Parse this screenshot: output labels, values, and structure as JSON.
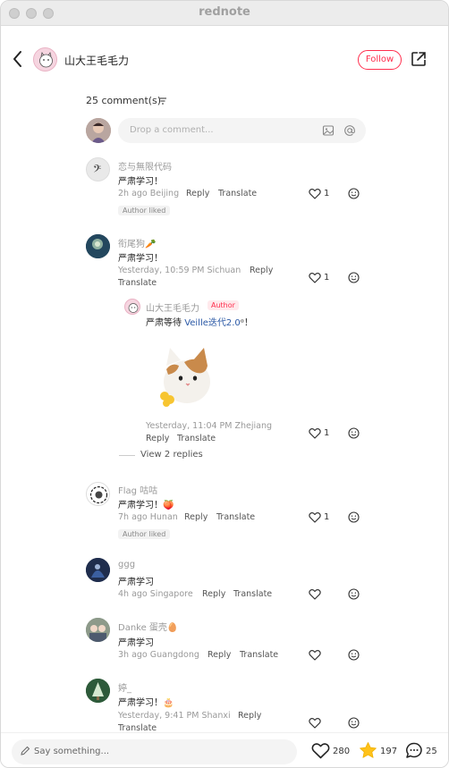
{
  "window": {
    "title": "rednote"
  },
  "header": {
    "author_name": "山大王毛毛力",
    "follow_label": "Follow"
  },
  "comments_section": {
    "count_label": "25 comment(s)",
    "input_placeholder": "Drop a comment..."
  },
  "comments": [
    {
      "name": "恋与無限代码",
      "text": "严肃学习！",
      "meta": "2h ago Beijing",
      "reply": "Reply",
      "translate": "Translate",
      "likes": "1",
      "badge": "Author liked"
    },
    {
      "name": "衔尾狗🥕",
      "text": "严肃学习！",
      "meta": "Yesterday, 10:59 PM Sichuan",
      "reply": "Reply",
      "translate": "Translate",
      "likes": "1",
      "reply_item": {
        "name": "山大王毛毛力",
        "author_badge": "Author",
        "text_prefix": "严肃等待 ",
        "text_link": "Veille迭代2.0",
        "text_suffix": "ᵅ！",
        "meta": "Yesterday, 11:04 PM Zhejiang",
        "reply": "Reply",
        "translate": "Translate",
        "likes": "1"
      },
      "view_replies": "View 2 replies"
    },
    {
      "name": "Flag 咕咕",
      "text": "严肃学习！🍑",
      "meta": "7h ago Hunan",
      "reply": "Reply",
      "translate": "Translate",
      "likes": "1",
      "badge": "Author liked"
    },
    {
      "name": "ggg",
      "text": "严肃学习",
      "meta": "4h ago Singapore",
      "reply": "Reply",
      "translate": "Translate"
    },
    {
      "name": "Danke 蛋壳🥚",
      "text": "严肃学习",
      "meta": "3h ago Guangdong",
      "reply": "Reply",
      "translate": "Translate"
    },
    {
      "name": "婷_",
      "text": "严肃学习！🎂",
      "meta": "Yesterday, 9:41 PM Shanxi",
      "reply": "Reply",
      "translate": "Translate"
    }
  ],
  "bottom_bar": {
    "say_placeholder": "Say something...",
    "likes": "280",
    "stars": "197",
    "comments": "25"
  },
  "colors": {
    "accent": "#ff2e4d",
    "link": "#2b59a6",
    "star": "#ffc21a"
  },
  "icons": [
    "back-arrow-icon",
    "share-icon",
    "filter-icon",
    "image-icon",
    "at-icon",
    "heart-icon",
    "emoji-icon",
    "pen-icon",
    "star-icon",
    "comment-bubble-icon"
  ]
}
